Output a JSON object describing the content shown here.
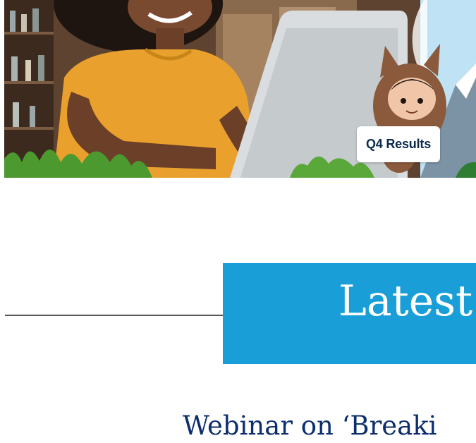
{
  "hero": {
    "badge_text": "Q4 Results",
    "image_icon": "hero-photo-woman-laptop-mascot"
  },
  "latest": {
    "title": "Latest N"
  },
  "webinar": {
    "heading": "Webinar on ‘Breaki"
  },
  "colors": {
    "latest_block_bg": "#1a9ed8",
    "heading_text": "#0d2e6e",
    "divider": "#5a5a5a"
  }
}
